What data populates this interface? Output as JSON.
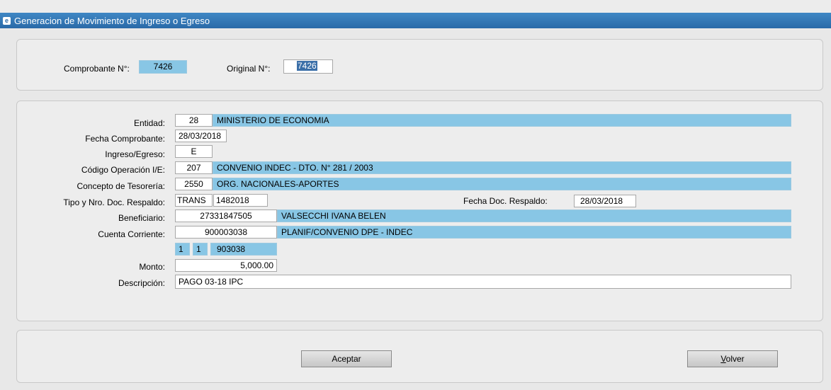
{
  "window": {
    "title": "Generacion de Movimiento de Ingreso o Egreso"
  },
  "header": {
    "comprobante_label": "Comprobante N°:",
    "comprobante_value": "7426",
    "original_label": "Original N°:",
    "original_value": "7426"
  },
  "form": {
    "entidad": {
      "label": "Entidad:",
      "code": "28",
      "desc": "MINISTERIO DE ECONOMIA"
    },
    "fecha_comprobante": {
      "label": "Fecha Comprobante:",
      "value": "28/03/2018"
    },
    "ingreso_egreso": {
      "label": "Ingreso/Egreso:",
      "value": "E"
    },
    "codigo_operacion": {
      "label": "Código Operación I/E:",
      "code": "207",
      "desc": "CONVENIO INDEC - DTO. N° 281 / 2003"
    },
    "concepto_tesoreria": {
      "label": "Concepto de Tesorería:",
      "code": "2550",
      "desc": "ORG. NACIONALES-APORTES"
    },
    "tipo_nro_doc": {
      "label": "Tipo y Nro. Doc. Respaldo:",
      "tipo": "TRANS",
      "nro": "1482018"
    },
    "fecha_doc": {
      "label": "Fecha Doc. Respaldo:",
      "value": "28/03/2018"
    },
    "beneficiario": {
      "label": "Beneficiario:",
      "code": "27331847505",
      "desc": "VALSECCHI IVANA BELEN"
    },
    "cuenta_corriente": {
      "label": "Cuenta Corriente:",
      "code": "900003038",
      "desc": "PLANIF/CONVENIO DPE - INDEC",
      "sub1": "1",
      "sub2": "1",
      "sub3": "903038"
    },
    "monto": {
      "label": "Monto:",
      "value": "5,000.00"
    },
    "descripcion": {
      "label": "Descripción:",
      "value": "PAGO 03-18 IPC"
    }
  },
  "buttons": {
    "aceptar": "Aceptar",
    "volver_u": "V",
    "volver_rest": "olver"
  },
  "colors": {
    "titlebar": "#2a6aa8",
    "readonly_field": "#88c6e5",
    "selection": "#3b6fa8"
  }
}
